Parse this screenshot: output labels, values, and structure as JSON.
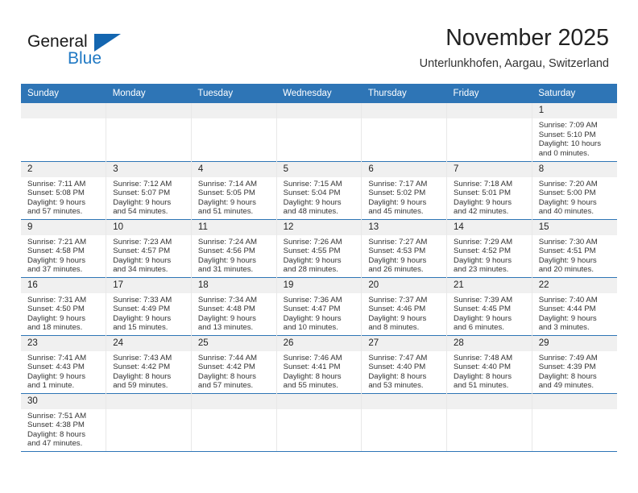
{
  "brand": {
    "name_part1": "General",
    "name_part2": "Blue",
    "triangle_color": "#1466b0",
    "blue_text_color": "#2079c4"
  },
  "header": {
    "title": "November 2025",
    "subtitle": "Unterlunkhofen, Aargau, Switzerland"
  },
  "theme": {
    "header_bg": "#2e75b6",
    "daynum_bg": "#f0f0f0",
    "row_divider": "#2e75b6"
  },
  "calendar": {
    "weekday_headers": [
      "Sunday",
      "Monday",
      "Tuesday",
      "Wednesday",
      "Thursday",
      "Friday",
      "Saturday"
    ],
    "weeks": [
      [
        {
          "day": "",
          "lines": []
        },
        {
          "day": "",
          "lines": []
        },
        {
          "day": "",
          "lines": []
        },
        {
          "day": "",
          "lines": []
        },
        {
          "day": "",
          "lines": []
        },
        {
          "day": "",
          "lines": []
        },
        {
          "day": "1",
          "lines": [
            "Sunrise: 7:09 AM",
            "Sunset: 5:10 PM",
            "Daylight: 10 hours",
            "and 0 minutes."
          ]
        }
      ],
      [
        {
          "day": "2",
          "lines": [
            "Sunrise: 7:11 AM",
            "Sunset: 5:08 PM",
            "Daylight: 9 hours",
            "and 57 minutes."
          ]
        },
        {
          "day": "3",
          "lines": [
            "Sunrise: 7:12 AM",
            "Sunset: 5:07 PM",
            "Daylight: 9 hours",
            "and 54 minutes."
          ]
        },
        {
          "day": "4",
          "lines": [
            "Sunrise: 7:14 AM",
            "Sunset: 5:05 PM",
            "Daylight: 9 hours",
            "and 51 minutes."
          ]
        },
        {
          "day": "5",
          "lines": [
            "Sunrise: 7:15 AM",
            "Sunset: 5:04 PM",
            "Daylight: 9 hours",
            "and 48 minutes."
          ]
        },
        {
          "day": "6",
          "lines": [
            "Sunrise: 7:17 AM",
            "Sunset: 5:02 PM",
            "Daylight: 9 hours",
            "and 45 minutes."
          ]
        },
        {
          "day": "7",
          "lines": [
            "Sunrise: 7:18 AM",
            "Sunset: 5:01 PM",
            "Daylight: 9 hours",
            "and 42 minutes."
          ]
        },
        {
          "day": "8",
          "lines": [
            "Sunrise: 7:20 AM",
            "Sunset: 5:00 PM",
            "Daylight: 9 hours",
            "and 40 minutes."
          ]
        }
      ],
      [
        {
          "day": "9",
          "lines": [
            "Sunrise: 7:21 AM",
            "Sunset: 4:58 PM",
            "Daylight: 9 hours",
            "and 37 minutes."
          ]
        },
        {
          "day": "10",
          "lines": [
            "Sunrise: 7:23 AM",
            "Sunset: 4:57 PM",
            "Daylight: 9 hours",
            "and 34 minutes."
          ]
        },
        {
          "day": "11",
          "lines": [
            "Sunrise: 7:24 AM",
            "Sunset: 4:56 PM",
            "Daylight: 9 hours",
            "and 31 minutes."
          ]
        },
        {
          "day": "12",
          "lines": [
            "Sunrise: 7:26 AM",
            "Sunset: 4:55 PM",
            "Daylight: 9 hours",
            "and 28 minutes."
          ]
        },
        {
          "day": "13",
          "lines": [
            "Sunrise: 7:27 AM",
            "Sunset: 4:53 PM",
            "Daylight: 9 hours",
            "and 26 minutes."
          ]
        },
        {
          "day": "14",
          "lines": [
            "Sunrise: 7:29 AM",
            "Sunset: 4:52 PM",
            "Daylight: 9 hours",
            "and 23 minutes."
          ]
        },
        {
          "day": "15",
          "lines": [
            "Sunrise: 7:30 AM",
            "Sunset: 4:51 PM",
            "Daylight: 9 hours",
            "and 20 minutes."
          ]
        }
      ],
      [
        {
          "day": "16",
          "lines": [
            "Sunrise: 7:31 AM",
            "Sunset: 4:50 PM",
            "Daylight: 9 hours",
            "and 18 minutes."
          ]
        },
        {
          "day": "17",
          "lines": [
            "Sunrise: 7:33 AM",
            "Sunset: 4:49 PM",
            "Daylight: 9 hours",
            "and 15 minutes."
          ]
        },
        {
          "day": "18",
          "lines": [
            "Sunrise: 7:34 AM",
            "Sunset: 4:48 PM",
            "Daylight: 9 hours",
            "and 13 minutes."
          ]
        },
        {
          "day": "19",
          "lines": [
            "Sunrise: 7:36 AM",
            "Sunset: 4:47 PM",
            "Daylight: 9 hours",
            "and 10 minutes."
          ]
        },
        {
          "day": "20",
          "lines": [
            "Sunrise: 7:37 AM",
            "Sunset: 4:46 PM",
            "Daylight: 9 hours",
            "and 8 minutes."
          ]
        },
        {
          "day": "21",
          "lines": [
            "Sunrise: 7:39 AM",
            "Sunset: 4:45 PM",
            "Daylight: 9 hours",
            "and 6 minutes."
          ]
        },
        {
          "day": "22",
          "lines": [
            "Sunrise: 7:40 AM",
            "Sunset: 4:44 PM",
            "Daylight: 9 hours",
            "and 3 minutes."
          ]
        }
      ],
      [
        {
          "day": "23",
          "lines": [
            "Sunrise: 7:41 AM",
            "Sunset: 4:43 PM",
            "Daylight: 9 hours",
            "and 1 minute."
          ]
        },
        {
          "day": "24",
          "lines": [
            "Sunrise: 7:43 AM",
            "Sunset: 4:42 PM",
            "Daylight: 8 hours",
            "and 59 minutes."
          ]
        },
        {
          "day": "25",
          "lines": [
            "Sunrise: 7:44 AM",
            "Sunset: 4:42 PM",
            "Daylight: 8 hours",
            "and 57 minutes."
          ]
        },
        {
          "day": "26",
          "lines": [
            "Sunrise: 7:46 AM",
            "Sunset: 4:41 PM",
            "Daylight: 8 hours",
            "and 55 minutes."
          ]
        },
        {
          "day": "27",
          "lines": [
            "Sunrise: 7:47 AM",
            "Sunset: 4:40 PM",
            "Daylight: 8 hours",
            "and 53 minutes."
          ]
        },
        {
          "day": "28",
          "lines": [
            "Sunrise: 7:48 AM",
            "Sunset: 4:40 PM",
            "Daylight: 8 hours",
            "and 51 minutes."
          ]
        },
        {
          "day": "29",
          "lines": [
            "Sunrise: 7:49 AM",
            "Sunset: 4:39 PM",
            "Daylight: 8 hours",
            "and 49 minutes."
          ]
        }
      ],
      [
        {
          "day": "30",
          "lines": [
            "Sunrise: 7:51 AM",
            "Sunset: 4:38 PM",
            "Daylight: 8 hours",
            "and 47 minutes."
          ]
        },
        {
          "day": "",
          "lines": []
        },
        {
          "day": "",
          "lines": []
        },
        {
          "day": "",
          "lines": []
        },
        {
          "day": "",
          "lines": []
        },
        {
          "day": "",
          "lines": []
        },
        {
          "day": "",
          "lines": []
        }
      ]
    ]
  }
}
